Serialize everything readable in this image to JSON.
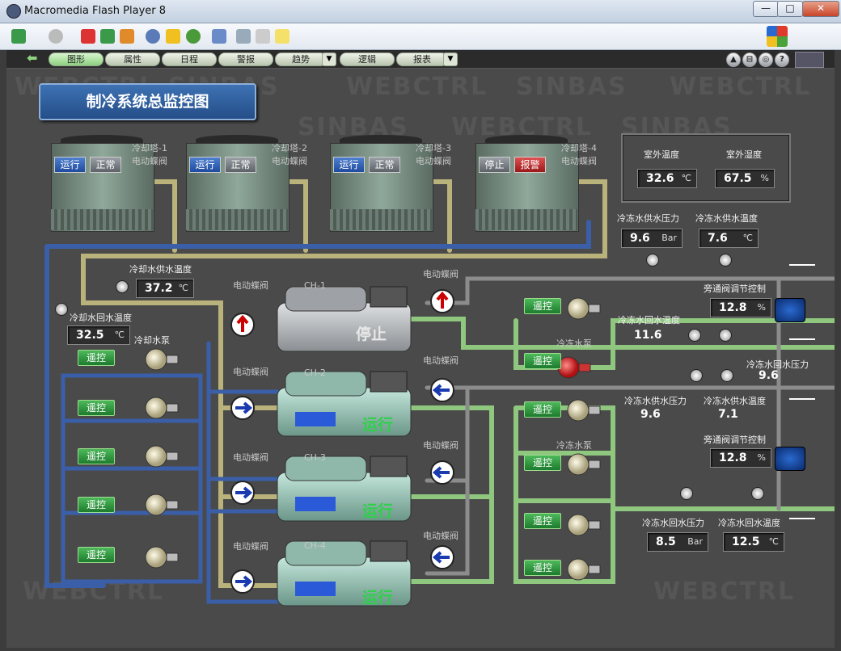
{
  "window": {
    "title": "Macromedia Flash Player 8",
    "minimize": "—",
    "maximize": "□",
    "close": "✕"
  },
  "nav": {
    "back": "⬅",
    "items": [
      "图形",
      "属性",
      "日程",
      "警报",
      "趋势",
      "逻辑",
      "报表"
    ],
    "active": "图形",
    "right_buttons": {
      "help": "?",
      "print": "⊟",
      "home": "▲"
    }
  },
  "page_title": "制冷系统总监控图",
  "watermark_words": [
    "SINBAS",
    "WEBCTRL"
  ],
  "towers": [
    {
      "name": "冷却塔-1",
      "valve_label": "电动蝶阀",
      "state": "运行",
      "mode": "正常"
    },
    {
      "name": "冷却塔-2",
      "valve_label": "电动蝶阀",
      "state": "运行",
      "mode": "正常"
    },
    {
      "name": "冷却塔-3",
      "valve_label": "电动蝶阀",
      "state": "运行",
      "mode": "正常"
    },
    {
      "name": "冷却塔-4",
      "valve_label": "电动蝶阀",
      "state": "停止",
      "mode": "报警"
    }
  ],
  "outdoor": {
    "temp_label": "室外温度",
    "temp_value": "32.6",
    "temp_unit": "℃",
    "hum_label": "室外湿度",
    "hum_value": "67.5",
    "hum_unit": "%"
  },
  "chilled_supply_top": {
    "pressure_label": "冷冻水供水压力",
    "pressure_value": "9.6",
    "pressure_unit": "Bar",
    "temp_label": "冷冻水供水温度",
    "temp_value": "7.6",
    "temp_unit": "℃"
  },
  "cooling_supply": {
    "label": "冷却水供水温度",
    "value": "37.2",
    "unit": "℃"
  },
  "cooling_return": {
    "label": "冷却水回水温度",
    "value": "32.5",
    "unit": "℃"
  },
  "cooling_pump_label": "冷却水泵",
  "remote_label": "遥控",
  "valve_label": "电动蝶阀",
  "chillers": [
    {
      "name": "CH-1",
      "state": "停止"
    },
    {
      "name": "CH-2",
      "state": "运行"
    },
    {
      "name": "CH-3",
      "state": "运行"
    },
    {
      "name": "CH-4",
      "state": "运行"
    }
  ],
  "bypass": {
    "label": "旁通阀调节控制",
    "value1": "12.8",
    "value2": "12.8",
    "unit": "%"
  },
  "chilled_return_temp_mid": {
    "label": "冷冻水回水温度",
    "value": "11.6"
  },
  "chilled_pump_label": "冷冻水泵",
  "chilled_return_pressure_mid": {
    "label": "冷冻水回水压力",
    "value": "9.6"
  },
  "chilled_supply_mid": {
    "pressure_label": "冷冻水供水压力",
    "pressure_value": "9.6",
    "temp_label": "冷冻水供水温度",
    "temp_value": "7.1"
  },
  "chilled_return_bottom": {
    "pressure_label": "冷冻水回水压力",
    "pressure_value": "8.5",
    "pressure_unit": "Bar",
    "temp_label": "冷冻水回水温度",
    "temp_value": "12.5",
    "temp_unit": "℃"
  },
  "colors": {
    "run": "#1f4b9e",
    "stop": "#5c6268",
    "alarm": "#9a1818",
    "remote": "#1d7b2d",
    "cooling_pipe": "#b9b27a",
    "chilled_pipe": "#8fc77f",
    "blue_pipe": "#3a5fa8"
  }
}
